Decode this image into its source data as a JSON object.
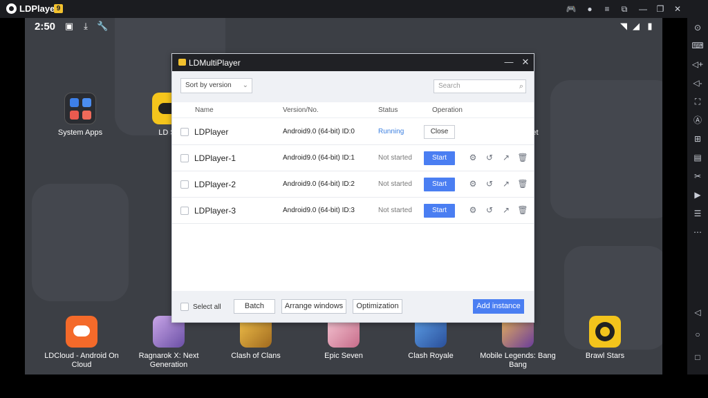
{
  "window": {
    "title": "LDPlayer",
    "badge": "9",
    "controls": [
      "gamepad-icon",
      "user-icon",
      "menu-icon",
      "resize-icon",
      "minimize-icon",
      "restore-icon",
      "close-icon"
    ]
  },
  "statusbar": {
    "time": "2:50"
  },
  "apps_top": [
    {
      "label": "System Apps"
    },
    {
      "label": "LD St"
    },
    {
      "label": "et"
    }
  ],
  "apps_bottom": [
    {
      "label": "LDCloud - Android On Cloud"
    },
    {
      "label": "Ragnarok X: Next Generation"
    },
    {
      "label": "Clash of Clans"
    },
    {
      "label": "Epic Seven"
    },
    {
      "label": "Clash Royale"
    },
    {
      "label": "Mobile Legends: Bang Bang"
    },
    {
      "label": "Brawl Stars"
    }
  ],
  "dialog": {
    "title": "LDMultiPlayer",
    "sort_label": "Sort by version",
    "search_placeholder": "Search",
    "columns": {
      "name": "Name",
      "version": "Version/No.",
      "status": "Status",
      "operation": "Operation"
    },
    "rows": [
      {
        "name": "LDPlayer",
        "version": "Android9.0 (64-bit) ID:0",
        "status": "Running",
        "action": "Close"
      },
      {
        "name": "LDPlayer-1",
        "version": "Android9.0 (64-bit) ID:1",
        "status": "Not started",
        "action": "Start"
      },
      {
        "name": "LDPlayer-2",
        "version": "Android9.0 (64-bit) ID:2",
        "status": "Not started",
        "action": "Start"
      },
      {
        "name": "LDPlayer-3",
        "version": "Android9.0 (64-bit) ID:3",
        "status": "Not started",
        "action": "Start"
      }
    ],
    "footer": {
      "select_all": "Select all",
      "batch": "Batch",
      "arrange": "Arrange windows",
      "optimization": "Optimization",
      "add": "Add instance"
    }
  },
  "colors": {
    "accent": "#4a7ef2",
    "running": "#3b7fe0",
    "titlebar": "#1b1c20",
    "desktop": "#3c3f45"
  }
}
